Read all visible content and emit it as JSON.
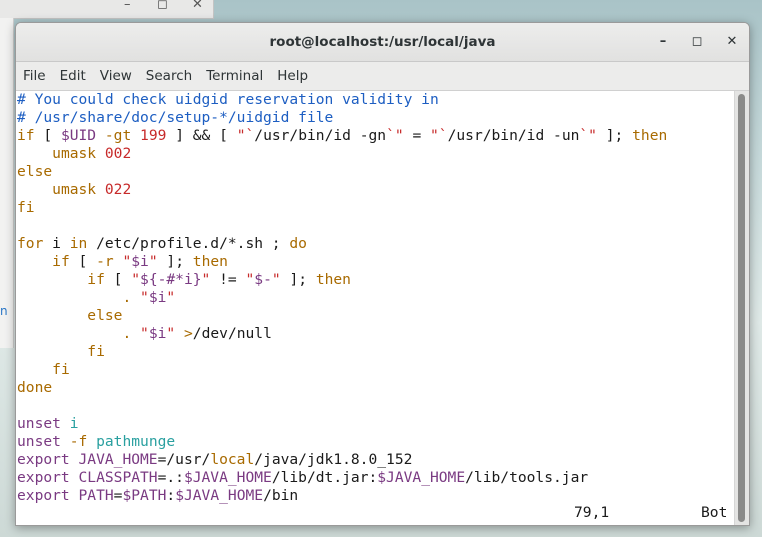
{
  "window": {
    "title": "root@localhost:/usr/local/java",
    "controls": {
      "minimize": "–",
      "maximize": "◻",
      "close": "✕"
    }
  },
  "background_window": {
    "minimize": "–",
    "maximize": "◻",
    "close": "✕"
  },
  "menu": [
    "File",
    "Edit",
    "View",
    "Search",
    "Terminal",
    "Help"
  ],
  "terminal": {
    "lines": [
      [
        [
          "c",
          "# You could check uidgid reservation validity in"
        ]
      ],
      [
        [
          "c",
          "# /usr/share/doc/setup-*/uidgid file"
        ]
      ],
      [
        [
          "k",
          "if"
        ],
        [
          "",
          " [ "
        ],
        [
          "v",
          "$UID"
        ],
        [
          "",
          " "
        ],
        [
          "k",
          "-gt"
        ],
        [
          "",
          " "
        ],
        [
          "s",
          "199"
        ],
        [
          "",
          " ] && [ "
        ],
        [
          "s",
          "\"`"
        ],
        [
          "",
          "/usr/bin/id -gn"
        ],
        [
          "s",
          "`\""
        ],
        [
          "",
          " = "
        ],
        [
          "s",
          "\"`"
        ],
        [
          "",
          "/usr/bin/id -un"
        ],
        [
          "s",
          "`\""
        ],
        [
          "",
          " ]; "
        ],
        [
          "k",
          "then"
        ]
      ],
      [
        [
          "",
          "    "
        ],
        [
          "k",
          "umask"
        ],
        [
          "",
          " "
        ],
        [
          "s",
          "002"
        ]
      ],
      [
        [
          "k",
          "else"
        ]
      ],
      [
        [
          "",
          "    "
        ],
        [
          "k",
          "umask"
        ],
        [
          "",
          " "
        ],
        [
          "s",
          "022"
        ]
      ],
      [
        [
          "k",
          "fi"
        ]
      ],
      [
        [
          "",
          ""
        ]
      ],
      [
        [
          "k",
          "for"
        ],
        [
          "",
          " i "
        ],
        [
          "k",
          "in"
        ],
        [
          "",
          " /etc/profile.d/*.sh ; "
        ],
        [
          "k",
          "do"
        ]
      ],
      [
        [
          "",
          "    "
        ],
        [
          "k",
          "if"
        ],
        [
          "",
          " [ "
        ],
        [
          "k",
          "-r"
        ],
        [
          "",
          " "
        ],
        [
          "s",
          "\""
        ],
        [
          "v",
          "$i"
        ],
        [
          "s",
          "\""
        ],
        [
          "",
          " ]; "
        ],
        [
          "k",
          "then"
        ]
      ],
      [
        [
          "",
          "        "
        ],
        [
          "k",
          "if"
        ],
        [
          "",
          " [ "
        ],
        [
          "s",
          "\""
        ],
        [
          "v",
          "${-#*i}"
        ],
        [
          "s",
          "\""
        ],
        [
          "",
          " != "
        ],
        [
          "s",
          "\""
        ],
        [
          "v",
          "$-"
        ],
        [
          "s",
          "\""
        ],
        [
          "",
          " ]; "
        ],
        [
          "k",
          "then"
        ]
      ],
      [
        [
          "",
          "            "
        ],
        [
          "k",
          "."
        ],
        [
          "",
          " "
        ],
        [
          "s",
          "\""
        ],
        [
          "v",
          "$i"
        ],
        [
          "s",
          "\""
        ]
      ],
      [
        [
          "",
          "        "
        ],
        [
          "k",
          "else"
        ]
      ],
      [
        [
          "",
          "            "
        ],
        [
          "k",
          "."
        ],
        [
          "",
          " "
        ],
        [
          "s",
          "\""
        ],
        [
          "v",
          "$i"
        ],
        [
          "s",
          "\""
        ],
        [
          "",
          " "
        ],
        [
          "k",
          ">"
        ],
        [
          "",
          "/dev/null"
        ]
      ],
      [
        [
          "",
          "        "
        ],
        [
          "k",
          "fi"
        ]
      ],
      [
        [
          "",
          "    "
        ],
        [
          "k",
          "fi"
        ]
      ],
      [
        [
          "k",
          "done"
        ]
      ],
      [
        [
          "",
          ""
        ]
      ],
      [
        [
          "v",
          "unset"
        ],
        [
          "",
          " "
        ],
        [
          "t",
          "i"
        ]
      ],
      [
        [
          "v",
          "unset"
        ],
        [
          "",
          " "
        ],
        [
          "k",
          "-f"
        ],
        [
          "",
          " "
        ],
        [
          "t",
          "pathmunge"
        ]
      ],
      [
        [
          "v",
          "export"
        ],
        [
          "",
          " "
        ],
        [
          "v",
          "JAVA_HOME"
        ],
        [
          "",
          "=/usr/"
        ],
        [
          "k",
          "local"
        ],
        [
          "",
          "/java/jdk1.8.0_152"
        ]
      ],
      [
        [
          "v",
          "export"
        ],
        [
          "",
          " "
        ],
        [
          "v",
          "CLASSPATH"
        ],
        [
          "",
          "=.:"
        ],
        [
          "v",
          "$JAVA_HOME"
        ],
        [
          "",
          "/lib/dt.jar:"
        ],
        [
          "v",
          "$JAVA_HOME"
        ],
        [
          "",
          "/lib/tools.jar"
        ]
      ],
      [
        [
          "v",
          "export"
        ],
        [
          "",
          " "
        ],
        [
          "v",
          "PATH"
        ],
        [
          "",
          "="
        ],
        [
          "v",
          "$PATH"
        ],
        [
          "",
          ":"
        ],
        [
          "v",
          "$JAVA_HOME"
        ],
        [
          "",
          "/bin"
        ]
      ]
    ],
    "status": {
      "position": "79,1",
      "percent": "Bot"
    }
  },
  "colors": {
    "comment": "#1d5ec2",
    "keyword": "#a86a00",
    "string": "#c72a2a",
    "variable": "#7a3a82",
    "identifier": "#2aa0a0"
  }
}
